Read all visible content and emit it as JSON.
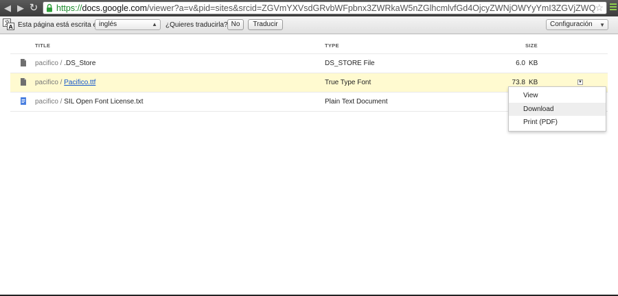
{
  "browser": {
    "url_scheme": "https://",
    "url_host": "docs.google.com",
    "url_rest": "/viewer?a=v&pid=sites&srcid=ZGVmYXVsdGRvbWFpbnx3ZWRkaW5nZGlhcmlvfGd4OjcyZWNjOWYyYmI3ZGVjZWQ",
    "back_icon": "arrow-left",
    "forward_icon": "arrow-right",
    "reload_icon": "reload",
    "star_icon": "star",
    "menu_icon": "wrench",
    "accent": "#1a8a2a"
  },
  "translate_bar": {
    "prefix": "Esta página está escrita en",
    "language": "inglés",
    "question": "¿Quieres traducirla?",
    "no_label": "No",
    "translate_label": "Traducir",
    "settings_label": "Configuración"
  },
  "table": {
    "headers": {
      "title": "TITLE",
      "type": "TYPE",
      "size": "SIZE"
    },
    "rows": [
      {
        "folder": "pacifico / ",
        "name": ".DS_Store",
        "type": "DS_STORE File",
        "size": "6.0",
        "unit": "KB",
        "icon": "file-icon"
      },
      {
        "folder": "pacifico / ",
        "name": "Pacifico.ttf",
        "type": "True Type Font",
        "size": "73.8",
        "unit": "KB",
        "icon": "file-icon"
      },
      {
        "folder": "pacifico / ",
        "name": "SIL Open Font License.txt",
        "type": "Plain Text Document",
        "size": "",
        "unit": "",
        "icon": "document-icon"
      }
    ],
    "highlight_color": "#fffad0"
  },
  "context_menu": {
    "items": [
      "View",
      "Download",
      "Print (PDF)"
    ],
    "active_item": "Download"
  }
}
